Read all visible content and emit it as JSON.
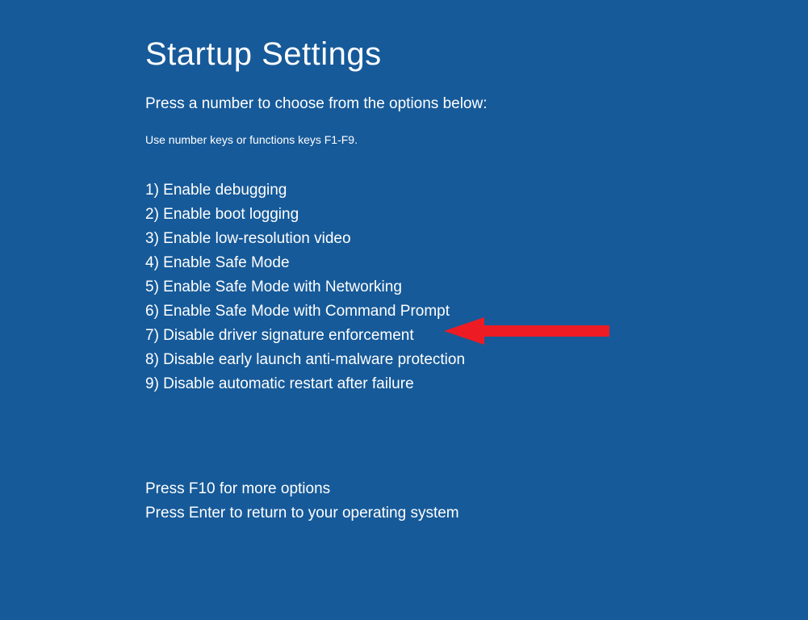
{
  "title": "Startup Settings",
  "subtitle": "Press a number to choose from the options below:",
  "hint": "Use number keys or functions keys F1-F9.",
  "options": [
    "1) Enable debugging",
    "2) Enable boot logging",
    "3) Enable low-resolution video",
    "4) Enable Safe Mode",
    "5) Enable Safe Mode with Networking",
    "6) Enable Safe Mode with Command Prompt",
    "7) Disable driver signature enforcement",
    "8) Disable early launch anti-malware protection",
    "9) Disable automatic restart after failure"
  ],
  "footer": {
    "more": "Press F10 for more options",
    "return": "Press Enter to return to your operating system"
  },
  "colors": {
    "background": "#165a99",
    "text": "#ffffff",
    "arrow": "#ed1c24"
  }
}
